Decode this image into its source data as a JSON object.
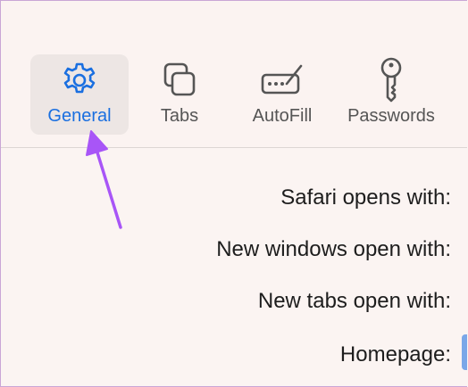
{
  "toolbar": {
    "tabs": [
      {
        "label": "General",
        "icon": "gear-icon",
        "selected": true
      },
      {
        "label": "Tabs",
        "icon": "tabs-icon",
        "selected": false
      },
      {
        "label": "AutoFill",
        "icon": "autofill-icon",
        "selected": false
      },
      {
        "label": "Passwords",
        "icon": "key-icon",
        "selected": false
      }
    ]
  },
  "general": {
    "safari_opens_with": "Safari opens with:",
    "new_windows_open_with": "New windows open with:",
    "new_tabs_open_with": "New tabs open with:",
    "homepage": "Homepage:"
  },
  "colors": {
    "accent": "#1a6fe0",
    "annotation_arrow": "#a855f7",
    "background": "#fbf4f2"
  }
}
